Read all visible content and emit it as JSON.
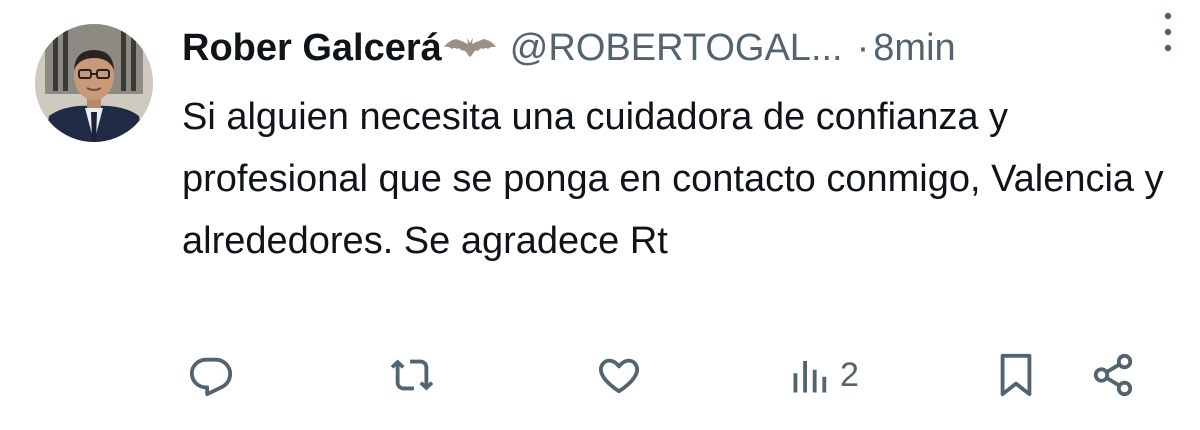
{
  "tweet": {
    "author": {
      "display_name": "Rober Galcerá",
      "badge_icon": "bat-icon",
      "handle": "@ROBERTOGAL...",
      "separator": "·",
      "time": "8min"
    },
    "text": "Si alguien necesita una cuidadora de confianza y profesional que se ponga en contacto conmigo, Valencia y alrededores. Se agradece Rt",
    "actions": {
      "reply": {
        "icon": "reply-icon"
      },
      "retweet": {
        "icon": "retweet-icon"
      },
      "like": {
        "icon": "heart-icon"
      },
      "views": {
        "icon": "views-icon",
        "count": "2"
      },
      "bookmark": {
        "icon": "bookmark-icon"
      },
      "share": {
        "icon": "share-icon"
      }
    }
  },
  "colors": {
    "text": "#0f1419",
    "secondary": "#536471",
    "background": "#ffffff"
  }
}
